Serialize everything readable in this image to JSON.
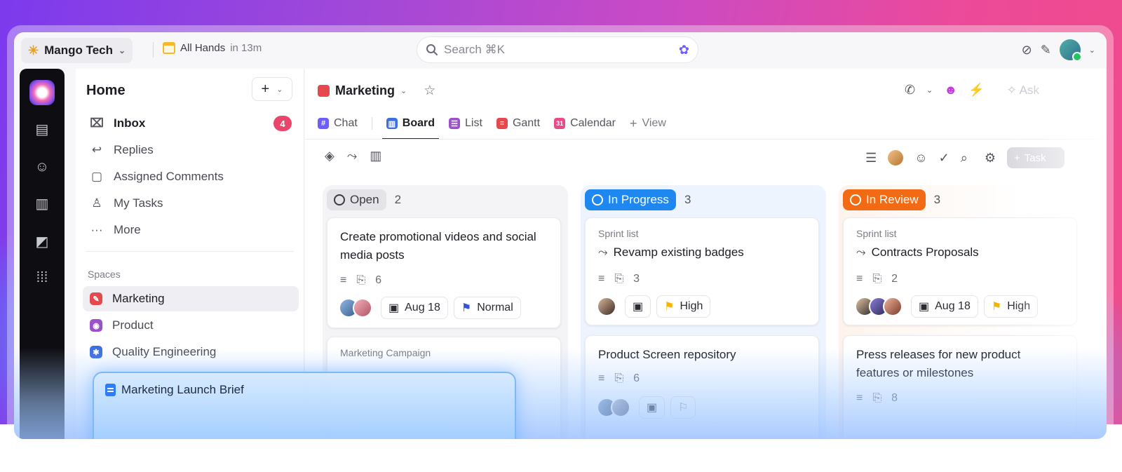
{
  "topbar": {
    "workspace": "Mango Tech",
    "event_title": "All Hands",
    "event_time": "in 13m",
    "search_placeholder": "Search ⌘K"
  },
  "sidebar": {
    "title": "Home",
    "add_label": "+",
    "items": [
      {
        "label": "Inbox",
        "badge": "4"
      },
      {
        "label": "Replies"
      },
      {
        "label": "Assigned Comments"
      },
      {
        "label": "My Tasks"
      },
      {
        "label": "More"
      }
    ],
    "spaces_label": "Spaces",
    "spaces": [
      {
        "label": "Marketing",
        "color": "#e5484d"
      },
      {
        "label": "Product",
        "color": "#9b51c9"
      },
      {
        "label": "Quality Engineering",
        "color": "#3e6fe0"
      }
    ]
  },
  "doc_popup": {
    "title": "Marketing Launch Brief"
  },
  "main": {
    "title": "Marketing",
    "ask_label": "Ask",
    "tabs": [
      {
        "label": "Chat",
        "color": "#6d5dfc"
      },
      {
        "label": "Board",
        "color": "#3e6fe0"
      },
      {
        "label": "List",
        "color": "#9b51c9"
      },
      {
        "label": "Gantt",
        "color": "#e5484d"
      },
      {
        "label": "Calendar",
        "color": "#e84a8a",
        "day": "31"
      },
      {
        "label": "View"
      }
    ],
    "task_button": "Task"
  },
  "board": {
    "columns": [
      {
        "status": "Open",
        "count": "2",
        "cards": [
          {
            "title": "Create promotional videos and social media posts",
            "attachments": "6",
            "date": "Aug 18",
            "priority": "Normal"
          },
          {
            "list": "Marketing Campaign"
          }
        ]
      },
      {
        "status": "In Progress",
        "count": "3",
        "cards": [
          {
            "list": "Sprint list",
            "title": "Revamp existing badges",
            "attachments": "3",
            "priority": "High"
          },
          {
            "title": "Product Screen repository",
            "attachments": "6"
          }
        ]
      },
      {
        "status": "In Review",
        "count": "3",
        "cards": [
          {
            "list": "Sprint list",
            "title": "Contracts Proposals",
            "attachments": "2",
            "date": "Aug 18",
            "priority": "High"
          },
          {
            "title": "Press releases for new product features or milestones",
            "attachments": "8"
          }
        ]
      }
    ]
  }
}
